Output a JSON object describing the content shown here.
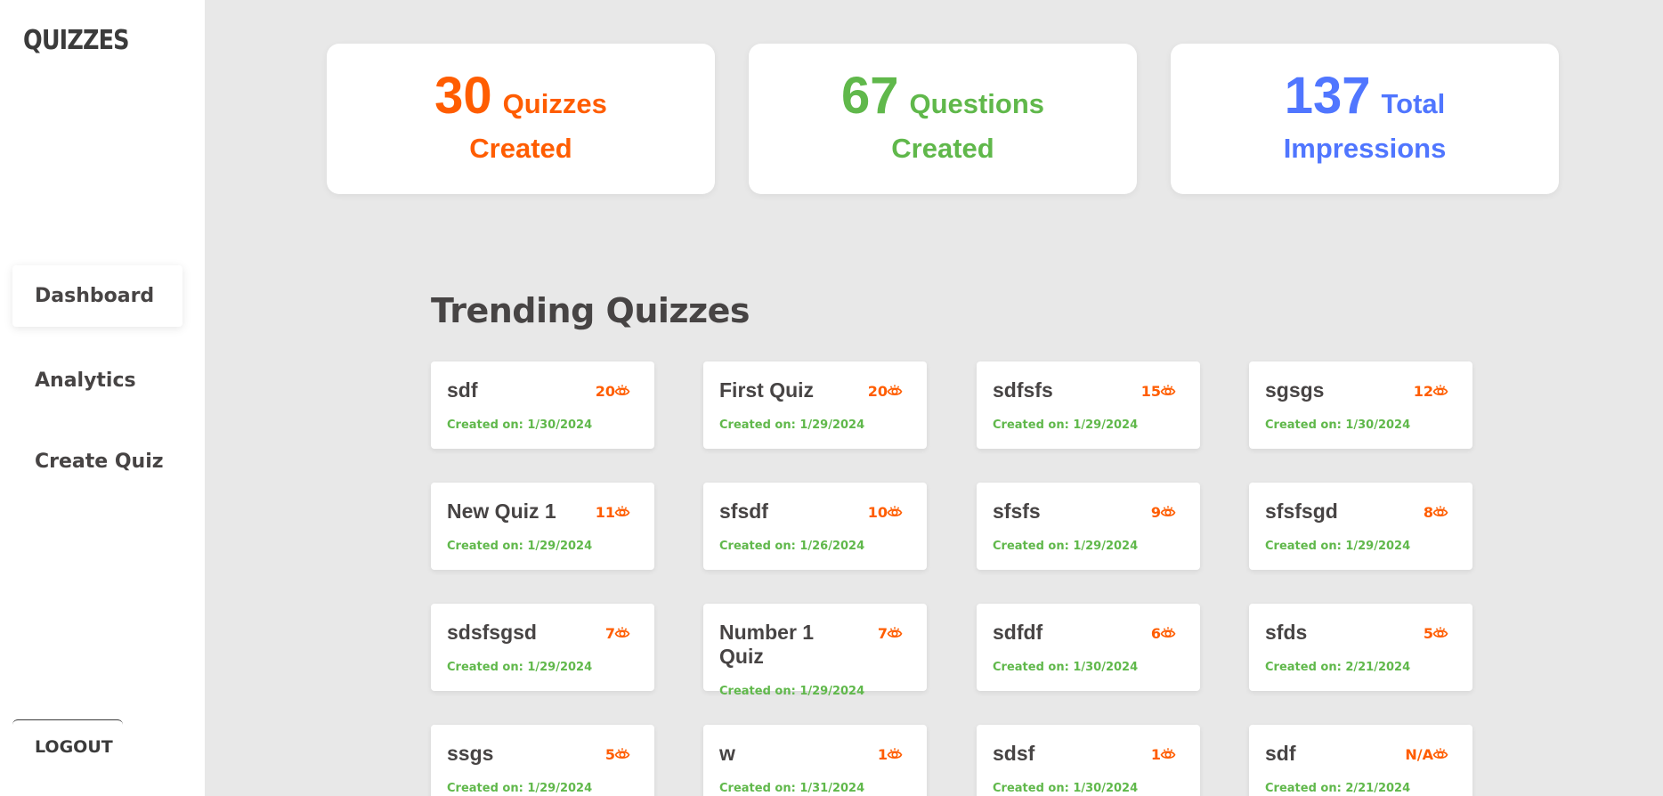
{
  "colors": {
    "orange": "#ff5d01",
    "green": "#60b84b",
    "blue": "#5076ff",
    "text_dark": "#474444"
  },
  "sidebar": {
    "logo": "QUIZZES",
    "items": [
      {
        "label": "Dashboard",
        "active": true
      },
      {
        "label": "Analytics",
        "active": false
      },
      {
        "label": "Create Quiz",
        "active": false
      }
    ],
    "logout_label": "LOGOUT"
  },
  "stats": [
    {
      "value": "30",
      "word": "Quizzes",
      "line2": "Created",
      "color": "#ff5d01"
    },
    {
      "value": "67",
      "word": "Questions",
      "line2": "Created",
      "color": "#60b84b"
    },
    {
      "value": "137",
      "word": "Total",
      "line2": "Impressions",
      "color": "#5076ff"
    }
  ],
  "trending": {
    "title": "Trending Quizzes",
    "eye_icon": "eye-icon",
    "quizzes": [
      {
        "name": "sdf",
        "views": "20",
        "date": "Created on: 1/30/2024"
      },
      {
        "name": "First Quiz",
        "views": "20",
        "date": "Created on: 1/29/2024"
      },
      {
        "name": "sdfsfs",
        "views": "15",
        "date": "Created on: 1/29/2024"
      },
      {
        "name": "sgsgs",
        "views": "12",
        "date": "Created on: 1/30/2024"
      },
      {
        "name": "New Quiz 1",
        "views": "11",
        "date": "Created on: 1/29/2024"
      },
      {
        "name": "sfsdf",
        "views": "10",
        "date": "Created on: 1/26/2024"
      },
      {
        "name": "sfsfs",
        "views": "9",
        "date": "Created on: 1/29/2024"
      },
      {
        "name": "sfsfsgd",
        "views": "8",
        "date": "Created on: 1/29/2024"
      },
      {
        "name": "sdsfsgsd",
        "views": "7",
        "date": "Created on: 1/29/2024"
      },
      {
        "name": "Number 1 Quiz",
        "views": "7",
        "date": "Created on: 1/29/2024"
      },
      {
        "name": "sdfdf",
        "views": "6",
        "date": "Created on: 1/30/2024"
      },
      {
        "name": "sfds",
        "views": "5",
        "date": "Created on: 2/21/2024"
      },
      {
        "name": "ssgs",
        "views": "5",
        "date": "Created on: 1/29/2024"
      },
      {
        "name": "w",
        "views": "1",
        "date": "Created on: 1/31/2024"
      },
      {
        "name": "sdsf",
        "views": "1",
        "date": "Created on: 1/30/2024"
      },
      {
        "name": "sdf",
        "views": "N/A",
        "date": "Created on: 2/21/2024"
      }
    ]
  }
}
